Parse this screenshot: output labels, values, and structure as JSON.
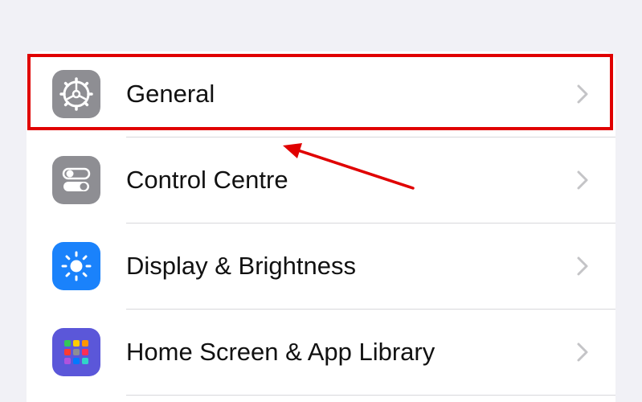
{
  "settings_list": {
    "items": [
      {
        "label": "General",
        "icon": "gear-icon",
        "icon_color": "#8e8e93"
      },
      {
        "label": "Control Centre",
        "icon": "toggle-switches-icon",
        "icon_color": "#8e8e93"
      },
      {
        "label": "Display & Brightness",
        "icon": "sun-icon",
        "icon_color": "#1a82fb"
      },
      {
        "label": "Home Screen & App Library",
        "icon": "app-grid-icon",
        "icon_color": "#5b57d9"
      }
    ]
  },
  "annotation": {
    "highlight_color": "#e00000",
    "highlighted_item": "General"
  }
}
